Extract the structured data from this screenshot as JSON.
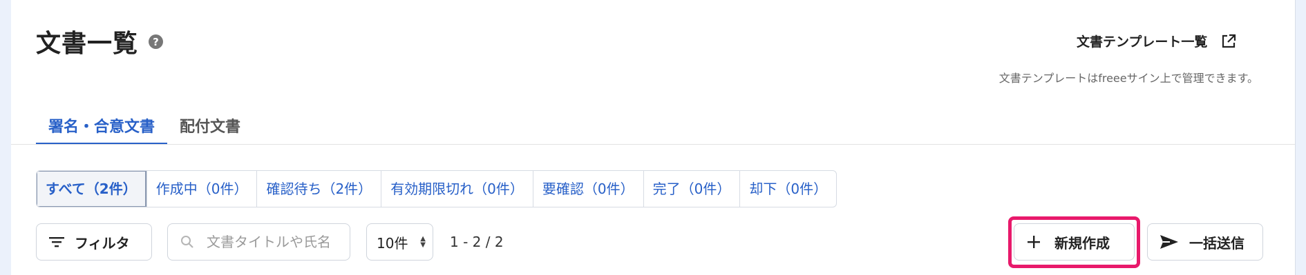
{
  "page": {
    "title": "文書一覧",
    "help_icon": "question-circle-icon"
  },
  "template_link": {
    "label": "文書テンプレート一覧",
    "icon": "external-link-icon",
    "note": "文書テンプレートはfreeeサイン上で管理できます。"
  },
  "tabs": [
    {
      "label": "署名・合意文書",
      "active": true
    },
    {
      "label": "配付文書",
      "active": false
    }
  ],
  "status_filters": [
    {
      "label": "すべて（2件）",
      "active": true
    },
    {
      "label": "作成中（0件）",
      "active": false
    },
    {
      "label": "確認待ち（2件）",
      "active": false
    },
    {
      "label": "有効期限切れ（0件）",
      "active": false
    },
    {
      "label": "要確認（0件）",
      "active": false
    },
    {
      "label": "完了（0件）",
      "active": false
    },
    {
      "label": "却下（0件）",
      "active": false
    }
  ],
  "toolbar": {
    "filter_label": "フィルタ",
    "filter_icon": "filter-lines-icon",
    "search_placeholder": "文書タイトルや氏名",
    "search_value": "",
    "search_icon": "search-icon",
    "per_page": "10件",
    "pagination": "1 - 2 / 2",
    "new_label": "新規作成",
    "new_icon": "plus-icon",
    "bulk_label": "一括送信",
    "bulk_icon": "send-icon"
  },
  "colors": {
    "accent": "#2860c8",
    "highlight": "#e8196b",
    "background": "#ebf1fb"
  }
}
